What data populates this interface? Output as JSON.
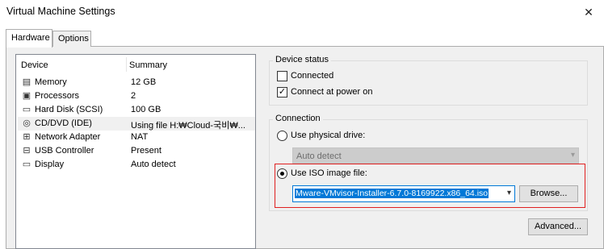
{
  "window": {
    "title": "Virtual Machine Settings",
    "close_glyph": "✕"
  },
  "tabs": [
    {
      "label": "Hardware",
      "active": true
    },
    {
      "label": "Options",
      "active": false
    }
  ],
  "device_list": {
    "headers": {
      "device": "Device",
      "summary": "Summary"
    },
    "rows": [
      {
        "icon": "memory-icon",
        "glyph": "▤",
        "name": "Memory",
        "summary": "12 GB"
      },
      {
        "icon": "processor-icon",
        "glyph": "▣",
        "name": "Processors",
        "summary": "2"
      },
      {
        "icon": "hard-disk-icon",
        "glyph": "▭",
        "name": "Hard Disk (SCSI)",
        "summary": "100 GB"
      },
      {
        "icon": "cd-dvd-icon",
        "glyph": "◎",
        "name": "CD/DVD (IDE)",
        "summary": "Using file H:₩Cloud-국비₩...",
        "selected": true
      },
      {
        "icon": "network-icon",
        "glyph": "⊞",
        "name": "Network Adapter",
        "summary": "NAT"
      },
      {
        "icon": "usb-icon",
        "glyph": "⊟",
        "name": "USB Controller",
        "summary": "Present"
      },
      {
        "icon": "display-icon",
        "glyph": "▭",
        "name": "Display",
        "summary": "Auto detect"
      }
    ]
  },
  "device_status": {
    "label": "Device status",
    "connected": {
      "label": "Connected",
      "checked": false
    },
    "connect_at_power_on": {
      "label": "Connect at power on",
      "checked": true
    }
  },
  "connection": {
    "label": "Connection",
    "physical_drive": {
      "label": "Use physical drive:",
      "selected": false,
      "value": "Auto detect"
    },
    "iso_image": {
      "label": "Use ISO image file:",
      "selected": true,
      "value": "Mware-VMvisor-Installer-6.7.0-8169922.x86_64.iso"
    },
    "browse_label": "Browse...",
    "advanced_label": "Advanced..."
  },
  "colors": {
    "accent": "#0078d7",
    "highlight_border": "#e02020"
  }
}
